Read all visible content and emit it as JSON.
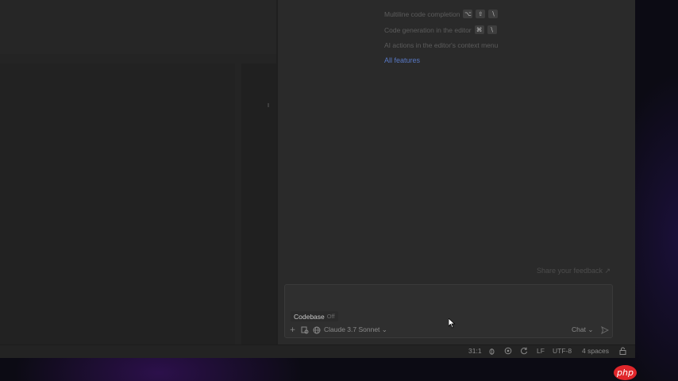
{
  "features": [
    {
      "label": "Multiline code completion",
      "keys": [
        "⌥",
        "⇧",
        "\\"
      ]
    },
    {
      "label": "Code generation in the editor",
      "keys": [
        "⌘",
        "\\"
      ]
    },
    {
      "label": "AI actions in the editor's context menu",
      "keys": []
    }
  ],
  "all_features_link": "All features",
  "feedback_link": "Share your feedback ↗",
  "chat": {
    "context_chip": {
      "label": "Codebase",
      "state": "Off"
    },
    "model_selector": "Claude 3.7 Sonnet ⌄",
    "mode_selector": "Chat ⌄",
    "icons": [
      "plus-icon",
      "attach-file-icon",
      "globe-icon",
      "send-icon"
    ]
  },
  "status_bar": {
    "position": "31:1",
    "line_ending": "LF",
    "encoding": "UTF-8",
    "indent": "4 spaces",
    "icons": [
      "bug-icon",
      "ai-assistant-icon",
      "sync-icon",
      "lock-icon"
    ]
  },
  "watermark": "php",
  "colors": {
    "panel_bg": "#2a2a2a",
    "link_blue": "#5878c4",
    "php_red": "#e0262b"
  }
}
